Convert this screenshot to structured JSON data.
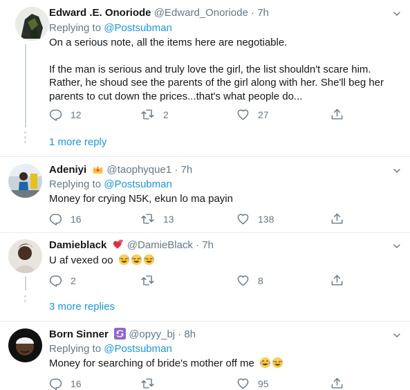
{
  "tweets": [
    {
      "name": "Edward .E. Onoriode",
      "handle": "@Edward_Onoriode",
      "time": "7h",
      "replying_label": "Replying to",
      "replying_handle": "@Postsubman",
      "paragraphs": [
        "On a serious note, all the items here are negotiable.",
        "If the man is serious and truly love the girl, the list shouldn't scare him. Rather, he shoud see the parents of the girl along with her. She'll beg her parents to cut down the prices...that's what people do..."
      ],
      "reply_count": "12",
      "retweet_count": "2",
      "like_count": "27",
      "more_replies": "1 more reply"
    },
    {
      "name": "Adeniyi",
      "name_emoji": "crown-emoji",
      "handle": "@taophyque1",
      "time": "7h",
      "replying_label": "Replying to",
      "replying_handle": "@Postsubman",
      "text": "Money for crying N5K, ekun lo ma payin",
      "reply_count": "16",
      "retweet_count": "13",
      "like_count": "138"
    },
    {
      "name": "Damieblack",
      "name_emoji": "heart-emoji",
      "handle": "@DamieBlack",
      "time": "7h",
      "text": "U af vexed oo",
      "text_emojis": [
        "rofl-emoji",
        "rofl-emoji",
        "rofl-emoji"
      ],
      "reply_count": "2",
      "retweet_count": "",
      "like_count": "8",
      "more_replies": "3 more replies"
    },
    {
      "name": "Born Sinner",
      "name_emoji": "cancer-zodiac-emoji",
      "handle": "@opyy_bj",
      "time": "8h",
      "replying_label": "Replying to",
      "replying_handle": "@Postsubman",
      "text": "Money for searching of bride's mother off me",
      "text_emojis": [
        "joy-emoji",
        "rofl-emoji"
      ],
      "reply_count": "16",
      "retweet_count": "",
      "like_count": "95"
    }
  ],
  "colors": {
    "link": "#1b95e0",
    "secondary_text": "#657786",
    "divider": "#e6ecf0",
    "thread_line": "#ccd6dd"
  }
}
